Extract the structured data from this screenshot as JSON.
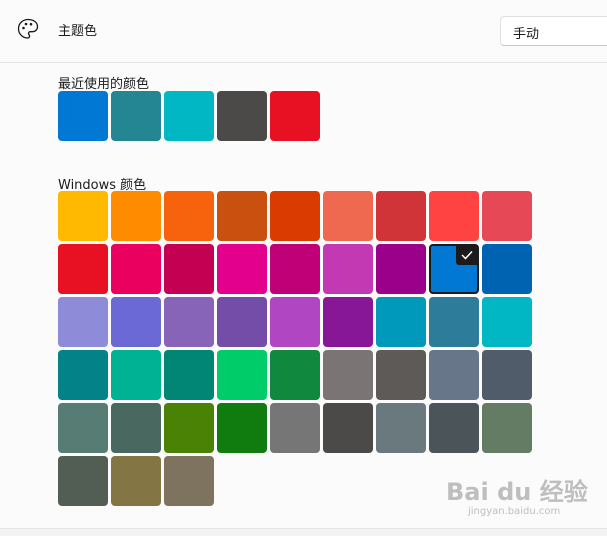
{
  "header": {
    "title": "主题色",
    "icon": "palette-icon",
    "dropdown_value": "手动"
  },
  "recent": {
    "label": "最近使用的颜色",
    "colors": [
      "#0078d4",
      "#238692",
      "#00b7c3",
      "#4c4a48",
      "#e81123"
    ]
  },
  "windows": {
    "label": "Windows 颜色",
    "selected_color": "#0078d4",
    "check_icon": "checkmark-icon",
    "rows": [
      [
        "#ffb900",
        "#ff8c00",
        "#f7630c",
        "#ca5010",
        "#da3b01",
        "#ef6950",
        "#d13438",
        "#ff4343",
        "#e74856"
      ],
      [
        "#e81123",
        "#ea005e",
        "#c30052",
        "#e3008c",
        "#bf0077",
        "#c239b3",
        "#9a0089",
        "#0078d4",
        "#0063b1"
      ],
      [
        "#8e8cd8",
        "#6b69d6",
        "#8764b8",
        "#744da9",
        "#b146c2",
        "#881798",
        "#0099bc",
        "#2d7d9a",
        "#00b7c3"
      ],
      [
        "#038387",
        "#00b294",
        "#018574",
        "#00cc6a",
        "#10893e",
        "#7a7574",
        "#5d5a58",
        "#68768a",
        "#515c6b"
      ],
      [
        "#567c73",
        "#486860",
        "#498205",
        "#107c10",
        "#767676",
        "#4c4a48",
        "#69797e",
        "#4a5459",
        "#647c64"
      ],
      [
        "#525e54",
        "#847545",
        "#7e735f"
      ]
    ]
  },
  "watermark": {
    "logo_text": "Bai du 经验",
    "url": "jingyan.baidu.com"
  }
}
